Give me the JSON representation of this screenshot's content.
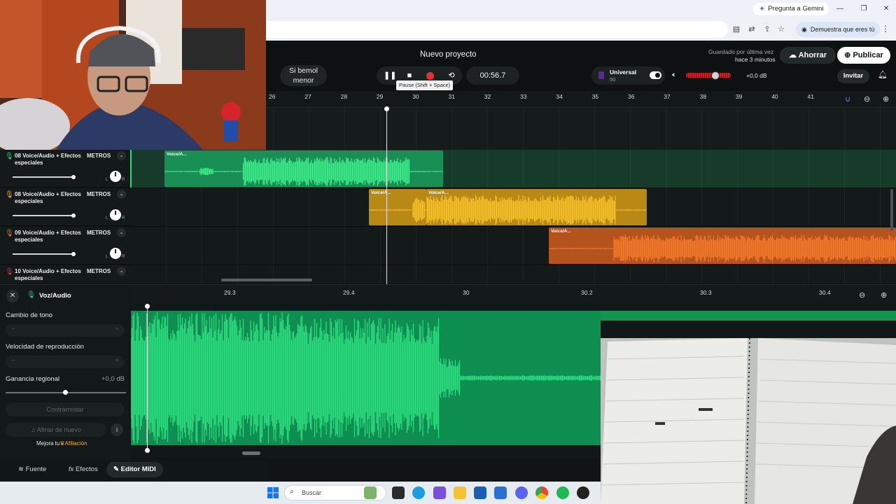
{
  "browser": {
    "gemini_label": "Pregunta a Gemini",
    "verify_label": "Demuestra que eres tú"
  },
  "header": {
    "project_title": "Nuevo proyecto",
    "key_label": "Si bemol menor",
    "time": "00:56.7",
    "tooltip": "Pause (Shift + Space)",
    "universal_label": "Universal",
    "universal_value": "50",
    "volume_db": "+0,0 dB",
    "saved_line1": "Guardado por última vez",
    "saved_line2": "hace 3 minutos",
    "save_label": "Ahorrar",
    "publish_label": "Publicar",
    "invite_label": "Invitar",
    "volume_level": 0.65
  },
  "ruler": {
    "bars": [
      "26",
      "27",
      "28",
      "29",
      "30",
      "31",
      "32",
      "33",
      "34",
      "35",
      "36",
      "37",
      "38",
      "39",
      "40",
      "41"
    ]
  },
  "tracks": [
    {
      "number": "08",
      "name": "Voice/Audio + Efectos especiales",
      "metronome": "METROS",
      "color": "#32d97a"
    },
    {
      "number": "08",
      "name": "Voice/Audio + Efectos especiales",
      "metronome": "METROS",
      "color": "#f5b21e"
    },
    {
      "number": "09",
      "name": "Voice/Audio + Efectos especiales",
      "metronome": "METROS",
      "color": "#f2752a"
    },
    {
      "number": "10",
      "name": "Voice/Audio + Efectos especiales",
      "metronome": "METROS",
      "color": "#e03a3a"
    }
  ],
  "clips": {
    "green": "Voice/A...",
    "yellow_a": "Voice/A...",
    "yellow_b": "Voice/A...",
    "orange": "Voice/A..."
  },
  "editor": {
    "title": "Voz/Audio",
    "pitch_label": "Cambio de tono",
    "speed_label": "Velocidad de reproducción",
    "gain_label": "Ganancia regional",
    "gain_value": "+0,0 dB",
    "reset_label": "Contrarrestar",
    "retune_label": "Afinar de nuevo",
    "upgrade_prefix": "Mejora tu",
    "upgrade_link": "Afiliación",
    "minus": "−",
    "plus": "+"
  },
  "bottom_tabs": {
    "source": "Fuente",
    "effects": "Efectos",
    "midi": "Editor MIDI"
  },
  "detail_ruler": {
    "ticks": [
      "29.3",
      "29.4",
      "30",
      "30.2",
      "30.3",
      "30.4"
    ]
  },
  "taskbar": {
    "search_placeholder": "Buscar"
  },
  "colors": {
    "accent_green": "#32d97a",
    "accent_yellow": "#f5b21e",
    "accent_orange": "#f2752a",
    "record_red": "#ef2a33"
  }
}
